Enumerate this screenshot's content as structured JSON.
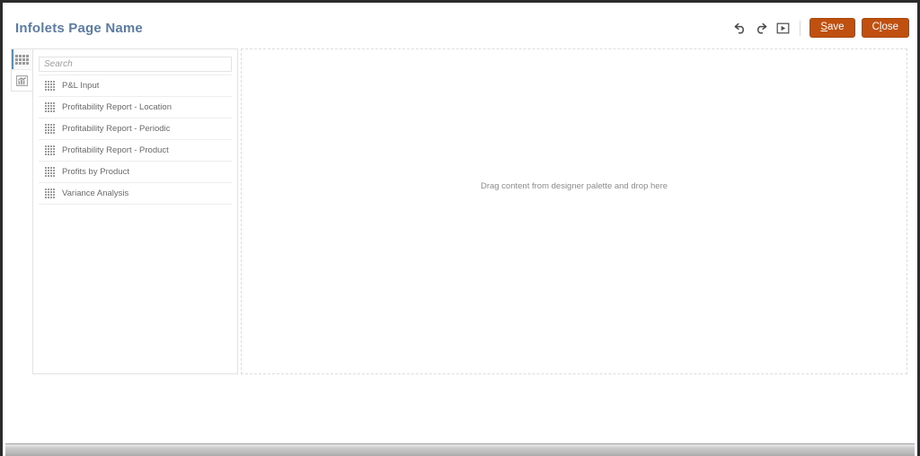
{
  "header": {
    "title": "Infolets Page Name",
    "title_color": "#5b7ca3"
  },
  "toolbar": {
    "undo_icon": "undo-icon",
    "redo_icon": "redo-icon",
    "run_icon": "run-play-icon",
    "save_label_prefix": "",
    "save_accel": "S",
    "save_label_rest": "ave",
    "close_label_prefix": "C",
    "close_accel": "l",
    "close_label_rest": "ose",
    "button_color": "#c0500f"
  },
  "rail": {
    "items": [
      {
        "name": "grid-view-tab",
        "icon": "grid-icon",
        "active": true
      },
      {
        "name": "chart-view-tab",
        "icon": "chart-icon",
        "active": false
      }
    ]
  },
  "palette": {
    "search": {
      "placeholder": "Search",
      "value": ""
    },
    "items": [
      {
        "label": "P&L Input",
        "icon": "grid-icon"
      },
      {
        "label": "Profitability Report - Location",
        "icon": "grid-icon"
      },
      {
        "label": "Profitability Report - Periodic",
        "icon": "grid-icon"
      },
      {
        "label": "Profitability Report - Product",
        "icon": "grid-icon"
      },
      {
        "label": "Profits by Product",
        "icon": "grid-icon"
      },
      {
        "label": "Variance Analysis",
        "icon": "grid-icon"
      }
    ]
  },
  "canvas": {
    "drop_hint": "Drag content from designer palette and drop here"
  }
}
